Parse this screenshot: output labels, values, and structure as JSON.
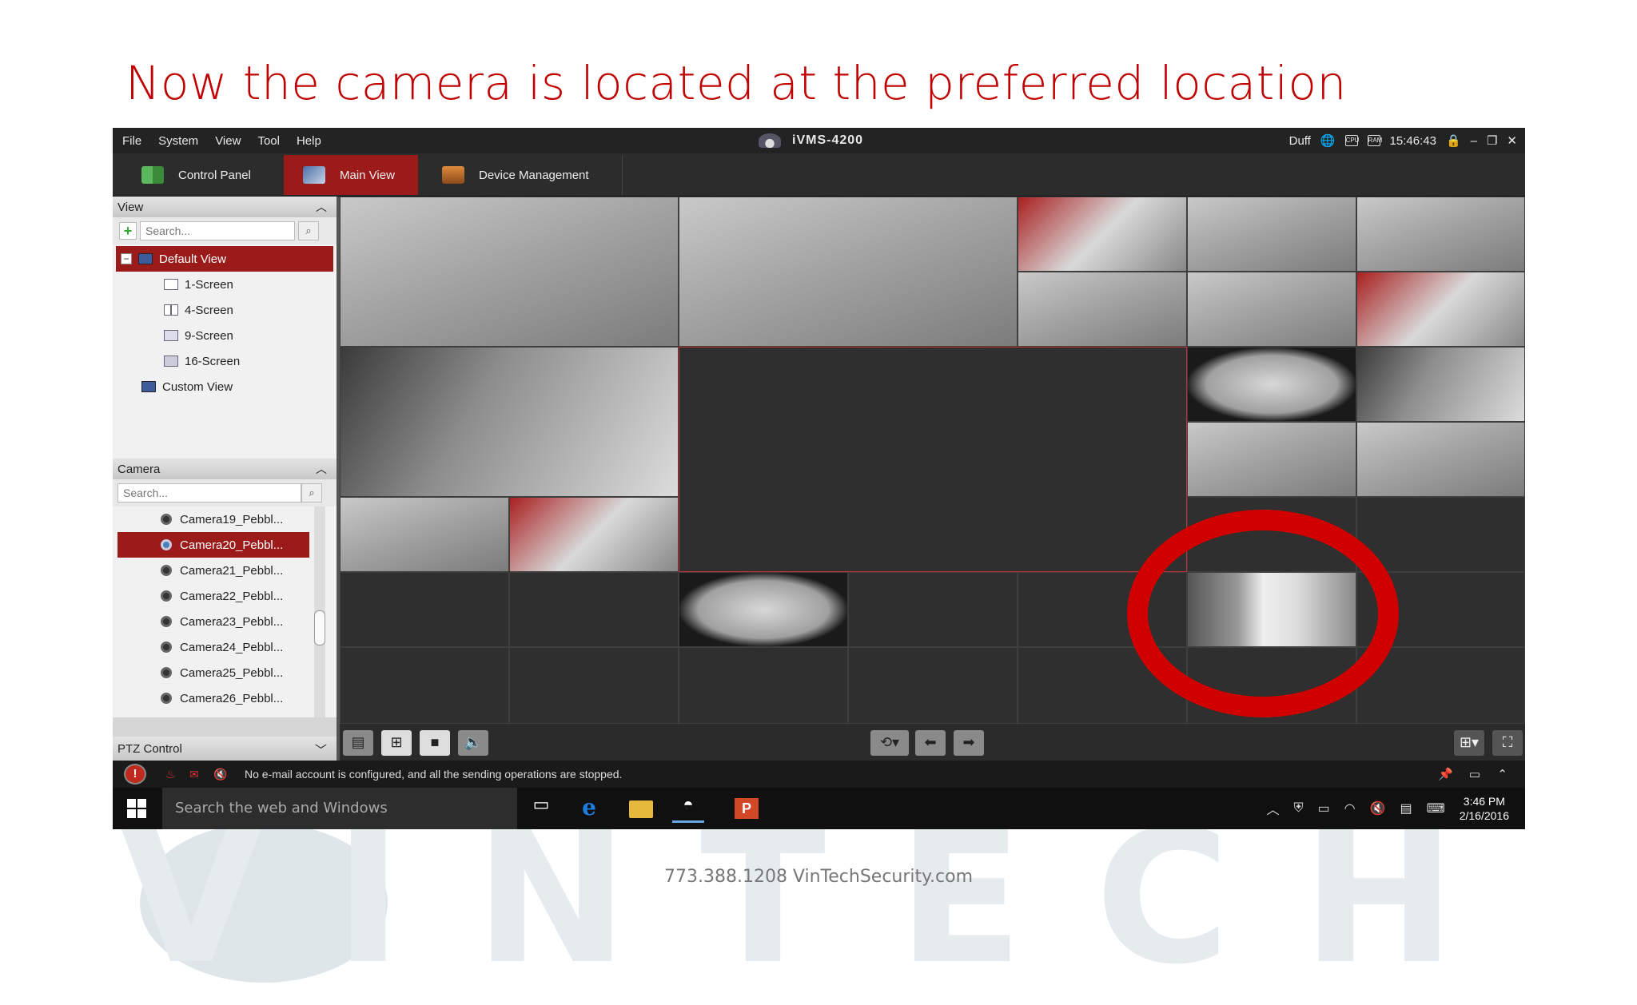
{
  "slide": {
    "title": "Now the camera is located at the preferred location",
    "footer": "773.388.1208   VinTechSecurity.com",
    "watermark": "VINTECH"
  },
  "app": {
    "menus": [
      "File",
      "System",
      "View",
      "Tool",
      "Help"
    ],
    "title": "iVMS-4200",
    "user": "Duff",
    "time": "15:46:43",
    "window_controls": [
      "lock-icon",
      "minimize-icon",
      "restore-icon",
      "close-icon"
    ]
  },
  "tabs": [
    {
      "label": "Control Panel",
      "active": false
    },
    {
      "label": "Main View",
      "active": true
    },
    {
      "label": "Device Management",
      "active": false
    }
  ],
  "view_panel": {
    "header": "View",
    "search_placeholder": "Search...",
    "items": [
      {
        "label": "Default View",
        "selected": true
      },
      {
        "label": "1-Screen"
      },
      {
        "label": "4-Screen"
      },
      {
        "label": "9-Screen"
      },
      {
        "label": "16-Screen"
      },
      {
        "label": "Custom View"
      }
    ]
  },
  "camera_panel": {
    "header": "Camera",
    "search_placeholder": "Search...",
    "cameras": [
      {
        "label": "Camera19_Pebbl...",
        "selected": false
      },
      {
        "label": "Camera20_Pebbl...",
        "selected": true
      },
      {
        "label": "Camera21_Pebbl...",
        "selected": false
      },
      {
        "label": "Camera22_Pebbl...",
        "selected": false
      },
      {
        "label": "Camera23_Pebbl...",
        "selected": false
      },
      {
        "label": "Camera24_Pebbl...",
        "selected": false
      },
      {
        "label": "Camera25_Pebbl...",
        "selected": false
      },
      {
        "label": "Camera26_Pebbl...",
        "selected": false
      }
    ]
  },
  "ptz": {
    "label": "PTZ Control"
  },
  "status": {
    "message": "No e-mail account is configured, and all the sending operations are stopped."
  },
  "taskbar": {
    "search_placeholder": "Search the web and Windows",
    "time": "3:46 PM",
    "date": "2/16/2016"
  },
  "colors": {
    "title_red": "#c00000",
    "active_tab": "#9b1b1b",
    "highlight_circle": "#d00000"
  }
}
